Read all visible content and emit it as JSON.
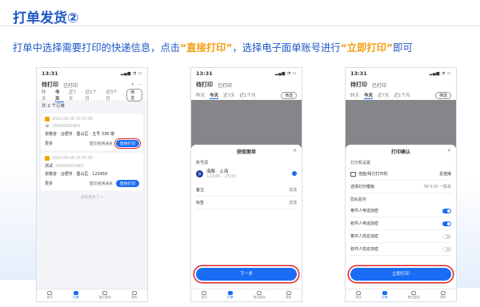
{
  "slide": {
    "title": "打单发货②",
    "desc_pre": "打单中选择需要打印的快递信息，点击",
    "desc_h1": "“直接打印”",
    "desc_mid": "，选择电子面单账号进行",
    "desc_h2": "“立即打印”",
    "desc_post": "即可"
  },
  "colors": {
    "brand_blue": "#1a6cf5",
    "title_blue": "#1d57c7",
    "highlight_orange": "#f39c12",
    "circle_red": "#e02020"
  },
  "phone": {
    "time": "13:31",
    "signal": "▂▄▆ ◔ ▭",
    "app_title": "待打印",
    "app_title2": "已打印",
    "tabs": [
      "昨天",
      "今天",
      "近7天",
      "近1个月",
      "近3个月"
    ],
    "filter": "筛选",
    "order_count": "共 2 个订单",
    "orders": [
      {
        "datetime": "2022-09-28 15:37:05",
        "phone": "15000281683",
        "address": "安徽省 · 合肥市 · 蜀山区 · 五号 336 楼",
        "more": "更多",
        "submit": "提交给快递员",
        "print": "直接打印"
      },
      {
        "name": "测试",
        "datetime": "2022-09-28 15:37:05",
        "phone": "15000281683",
        "address": "安徽省 · 合肥市 · 蜀山区 · 123456",
        "more": "更多",
        "submit": "提交给快递员",
        "print": "直接打印"
      }
    ],
    "no_more": "没有更多了～",
    "tabbar": [
      "首页",
      "打单",
      "售后服务",
      "我的"
    ]
  },
  "sheet2": {
    "title": "获取面单",
    "section": "账号源",
    "account_name": "海豚 · 上海",
    "account_sub": "12345 · 2500",
    "row1_label": "备注",
    "row1_value": "选填",
    "row2_label": "标签",
    "row2_value": "选填",
    "next": "下一步"
  },
  "sheet3": {
    "title": "打印确认",
    "section1": "打印机设置",
    "printer": "佳能/得力打印机",
    "printer_action": "去连接",
    "template_label": "选择打印模板",
    "template_value": "76*130 一联单",
    "section2": "隐私服务",
    "toggles": [
      {
        "label": "寄件人电话加密",
        "on": true
      },
      {
        "label": "收件人电话加密",
        "on": true
      },
      {
        "label": "寄件人姓名加密",
        "on": false
      },
      {
        "label": "收件人姓名加密",
        "on": false
      }
    ],
    "print_now": "立即打印"
  }
}
